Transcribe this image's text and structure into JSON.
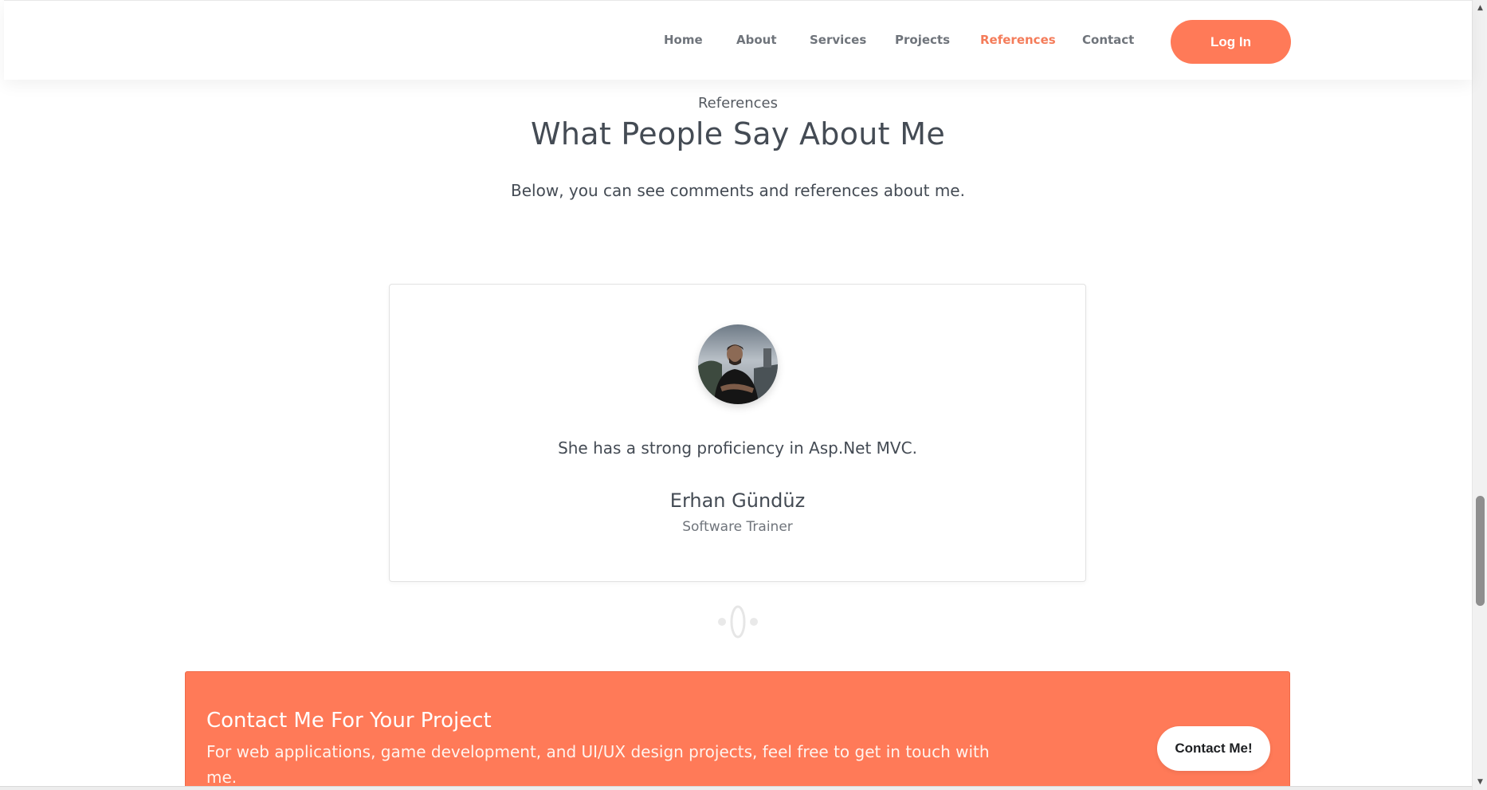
{
  "nav": {
    "items": [
      {
        "label": "Home",
        "active": false
      },
      {
        "label": "About",
        "active": false
      },
      {
        "label": "Services",
        "active": false
      },
      {
        "label": "Projects",
        "active": false
      },
      {
        "label": "References",
        "active": true
      },
      {
        "label": "Contact",
        "active": false
      }
    ],
    "login_label": "Log In"
  },
  "section": {
    "label": "References",
    "title": "What People Say About Me",
    "subtitle": "Below, you can see comments and references about me."
  },
  "testimonial": {
    "quote": "She has a strong proficiency in Asp.Net MVC.",
    "name": "Erhan Gündüz",
    "role": "Software Trainer",
    "avatar_icon": "person-photo"
  },
  "cta": {
    "title": "Contact Me For Your Project",
    "text": "For web applications, game development, and UI/UX design projects, feel free to get in touch with me.",
    "button_label": "Contact Me!"
  },
  "colors": {
    "accent": "#ff7a58",
    "text": "#444b54",
    "muted": "#6f747b"
  }
}
